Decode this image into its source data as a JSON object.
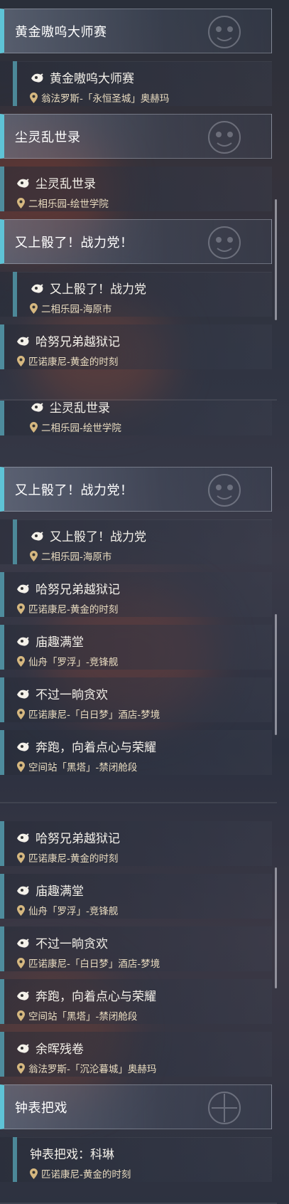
{
  "screens": [
    {
      "rows": [
        {
          "kind": "header",
          "title": "黄金嗷呜大师赛",
          "icon": "mascot-seal"
        },
        {
          "kind": "sub",
          "name": "黄金嗷呜大师赛",
          "loc": "翁法罗斯-「永恒圣城」奥赫玛",
          "icon": "quest-icon"
        },
        {
          "kind": "header",
          "title": "尘灵乱世录",
          "icon": "mascot-seal"
        },
        {
          "kind": "item",
          "name": "尘灵乱世录",
          "loc": "二相乐园-绘世学院",
          "icon": "quest-icon"
        },
        {
          "kind": "header",
          "title": "又上骰了！战力党！",
          "icon": "mascot-seal"
        },
        {
          "kind": "sub",
          "name": "又上骰了！战力党",
          "loc": "二相乐园-海原市",
          "icon": "quest-icon"
        },
        {
          "kind": "item",
          "name": "哈努兄弟越狱记",
          "loc": "匹诺康尼-黄金的时刻",
          "icon": "quest-icon"
        }
      ]
    },
    {
      "rows": [
        {
          "kind": "item",
          "name": "尘灵乱世录",
          "loc": "二相乐园-绘世学院",
          "icon": "quest-icon"
        },
        {
          "kind": "header",
          "title": "又上骰了！战力党！",
          "icon": "mascot-seal"
        },
        {
          "kind": "sub",
          "name": "又上骰了！战力党",
          "loc": "二相乐园-海原市",
          "icon": "quest-icon"
        },
        {
          "kind": "item",
          "name": "哈努兄弟越狱记",
          "loc": "匹诺康尼-黄金的时刻",
          "icon": "quest-icon"
        },
        {
          "kind": "item",
          "name": "庙趣满堂",
          "loc": "仙舟「罗浮」-竞锋舰",
          "icon": "quest-icon"
        },
        {
          "kind": "item",
          "name": "不过一晌贪欢",
          "loc": "匹诺康尼-「白日梦」酒店-梦境",
          "icon": "quest-icon"
        },
        {
          "kind": "item",
          "name": "奔跑，向着点心与荣耀",
          "loc": "空间站「黑塔」-禁闭舱段",
          "icon": "quest-icon"
        }
      ]
    },
    {
      "rows": [
        {
          "kind": "item",
          "name": "哈努兄弟越狱记",
          "loc": "匹诺康尼-黄金的时刻",
          "icon": "quest-icon"
        },
        {
          "kind": "item",
          "name": "庙趣满堂",
          "loc": "仙舟「罗浮」-竞锋舰",
          "icon": "quest-icon"
        },
        {
          "kind": "item",
          "name": "不过一晌贪欢",
          "loc": "匹诺康尼-「白日梦」酒店-梦境",
          "icon": "quest-icon"
        },
        {
          "kind": "item",
          "name": "奔跑，向着点心与荣耀",
          "loc": "空间站「黑塔」-禁闭舱段",
          "icon": "quest-icon"
        },
        {
          "kind": "item",
          "name": "余晖残卷",
          "loc": "翁法罗斯-「沉沦暮城」奥赫玛",
          "icon": "quest-icon"
        },
        {
          "kind": "header",
          "title": "钟表把戏",
          "icon": "mascot-seal"
        },
        {
          "kind": "sub",
          "name": "钟表把戏：科琳",
          "loc": "匹诺康尼-黄金的时刻",
          "icon": "quest-icon"
        }
      ]
    }
  ],
  "colors": {
    "accent": "#5ec3d6",
    "item_accent": "#4e8c9d",
    "location_text": "#e9dcc0",
    "pin": "#d6b880"
  }
}
